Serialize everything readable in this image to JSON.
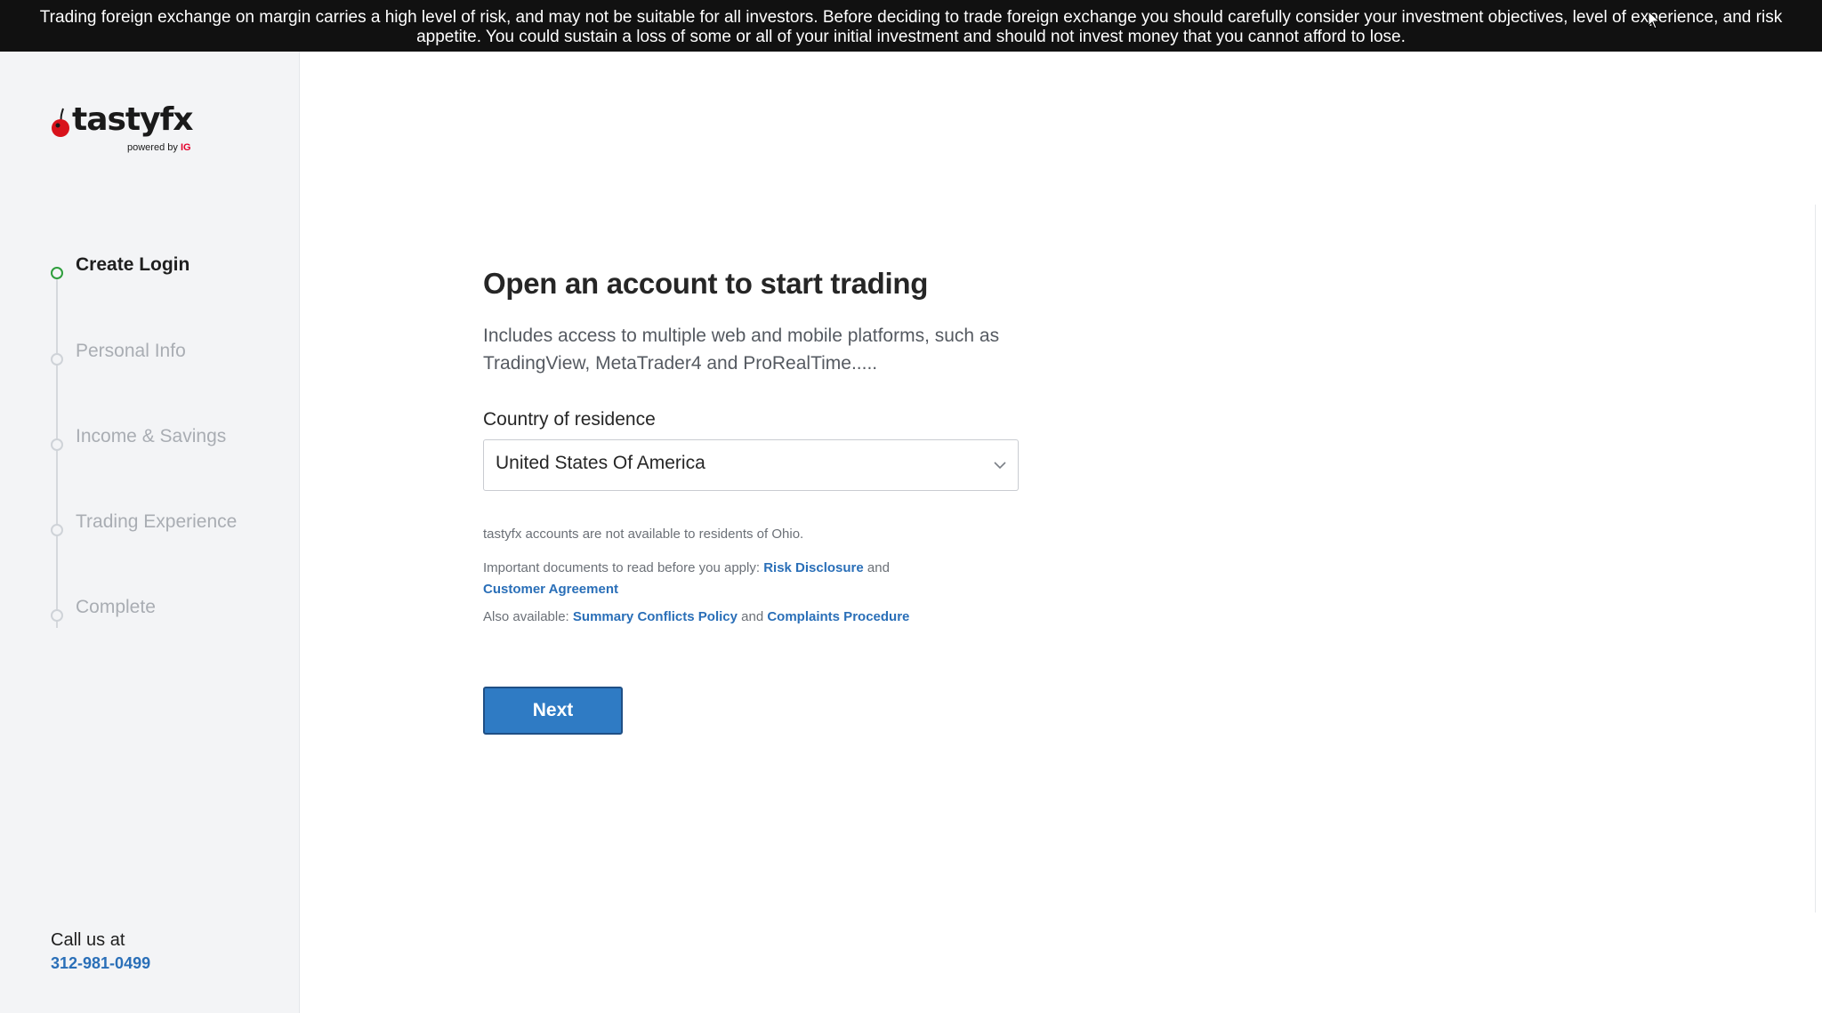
{
  "banner": {
    "text": "Trading foreign exchange on margin carries a high level of risk, and may not be suitable for all investors. Before deciding to trade foreign exchange you should carefully consider your investment objectives, level of experience, and risk appetite. You could sustain a loss of some or all of your initial investment and should not invest money that you cannot afford to lose."
  },
  "brand": {
    "name": "tastyfx",
    "powered_by": "powered by",
    "powered_brand": "IG"
  },
  "steps": [
    {
      "label": "Create Login",
      "state": "active"
    },
    {
      "label": "Personal Info",
      "state": "pending"
    },
    {
      "label": "Income & Savings",
      "state": "pending"
    },
    {
      "label": "Trading Experience",
      "state": "pending"
    },
    {
      "label": "Complete",
      "state": "pending"
    }
  ],
  "contact": {
    "label": "Call us at",
    "phone": "312-981-0499"
  },
  "form": {
    "title": "Open an account to start trading",
    "subtitle": "Includes access to multiple web and mobile platforms, such as TradingView, MetaTrader4 and ProRealTime.....",
    "country_label": "Country of residence",
    "country_value": "United States Of America",
    "note": "tastyfx accounts are not available to residents of Ohio.",
    "docs_prefix": "Important documents to read before you apply:",
    "docs_link1": "Risk Disclosure",
    "docs_and": "and",
    "docs_link2": "Customer Agreement",
    "also_prefix": "Also available:",
    "also_link1": "Summary Conflicts Policy",
    "also_and": "and",
    "also_link2": "Complaints Procedure",
    "next_label": "Next"
  },
  "colors": {
    "banner_bg": "#111111",
    "sidebar_bg": "#f3f4f6",
    "link": "#2a6fb8",
    "primary_button": "#2f7bc4",
    "active_step": "#2e9e3c"
  }
}
